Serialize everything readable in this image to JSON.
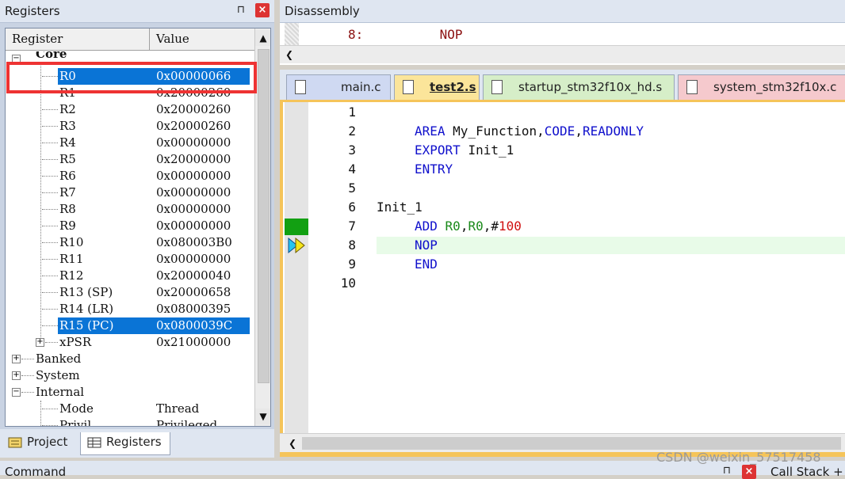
{
  "registers_panel": {
    "title": "Registers",
    "pin_glyph": "⊓",
    "close_glyph": "×",
    "headers": {
      "register": "Register",
      "value": "Value"
    },
    "core_label": "Core",
    "rows": [
      {
        "name": "R0",
        "value": "0x00000066",
        "selected": true
      },
      {
        "name": "R1",
        "value": "0x20000260",
        "selected": false
      },
      {
        "name": "R2",
        "value": "0x20000260",
        "selected": false
      },
      {
        "name": "R3",
        "value": "0x20000260",
        "selected": false
      },
      {
        "name": "R4",
        "value": "0x00000000",
        "selected": false
      },
      {
        "name": "R5",
        "value": "0x20000000",
        "selected": false
      },
      {
        "name": "R6",
        "value": "0x00000000",
        "selected": false
      },
      {
        "name": "R7",
        "value": "0x00000000",
        "selected": false
      },
      {
        "name": "R8",
        "value": "0x00000000",
        "selected": false
      },
      {
        "name": "R9",
        "value": "0x00000000",
        "selected": false
      },
      {
        "name": "R10",
        "value": "0x080003B0",
        "selected": false
      },
      {
        "name": "R11",
        "value": "0x00000000",
        "selected": false
      },
      {
        "name": "R12",
        "value": "0x20000040",
        "selected": false
      },
      {
        "name": "R13 (SP)",
        "value": "0x20000658",
        "selected": false
      },
      {
        "name": "R14 (LR)",
        "value": "0x08000395",
        "selected": false
      },
      {
        "name": "R15 (PC)",
        "value": "0x0800039C",
        "selected": true
      },
      {
        "name": "xPSR",
        "value": "0x21000000",
        "selected": false
      }
    ],
    "groups": [
      "Banked",
      "System",
      "Internal"
    ],
    "internal_mode": {
      "name": "Mode",
      "value": "Thread"
    },
    "internal_partial": {
      "name": "Privil",
      "value": "Privileged"
    },
    "tabs": {
      "project": "Project",
      "registers": "Registers"
    }
  },
  "disassembly": {
    "title": "Disassembly",
    "line": "8:          NOP"
  },
  "editor_tabs": [
    "main.c",
    "test2.s",
    "startup_stm32f10x_hd.s",
    "system_stm32f10x.c"
  ],
  "editor": {
    "line_numbers": [
      "1",
      "2",
      "3",
      "4",
      "5",
      "6",
      "7",
      "8",
      "9",
      "10"
    ],
    "lines": {
      "l2_kw": "AREA",
      "l2_name": "My_Function",
      "l2_attr1": "CODE",
      "l2_attr2": "READONLY",
      "l3_kw": "EXPORT",
      "l3_name": "Init_1",
      "l4_kw": "ENTRY",
      "l6_label": "Init_1",
      "l7_kw": "ADD",
      "l7_r1": "R0",
      "l7_r2": "R0",
      "l7_hash": "#",
      "l7_num": "100",
      "l8_kw": "NOP",
      "l9_kw": "END"
    },
    "current_line": 8
  },
  "bottom": {
    "command_label": "Command",
    "callstack_label": "Call Stack +"
  },
  "watermark": "CSDN @weixin_57517458",
  "colors": {
    "selection": "#0a74d6",
    "keyword": "#1010cc",
    "register": "#1a8a1a",
    "number": "#d01010",
    "current_line": "#e8fbe8",
    "red_annotation": "#ee3333"
  },
  "icons": {
    "pin": "pin-icon",
    "close": "close-icon",
    "project": "project-book-icon",
    "registers": "registers-icon",
    "document": "document-icon",
    "execution_arrow": "current-execution-arrow-icon"
  }
}
